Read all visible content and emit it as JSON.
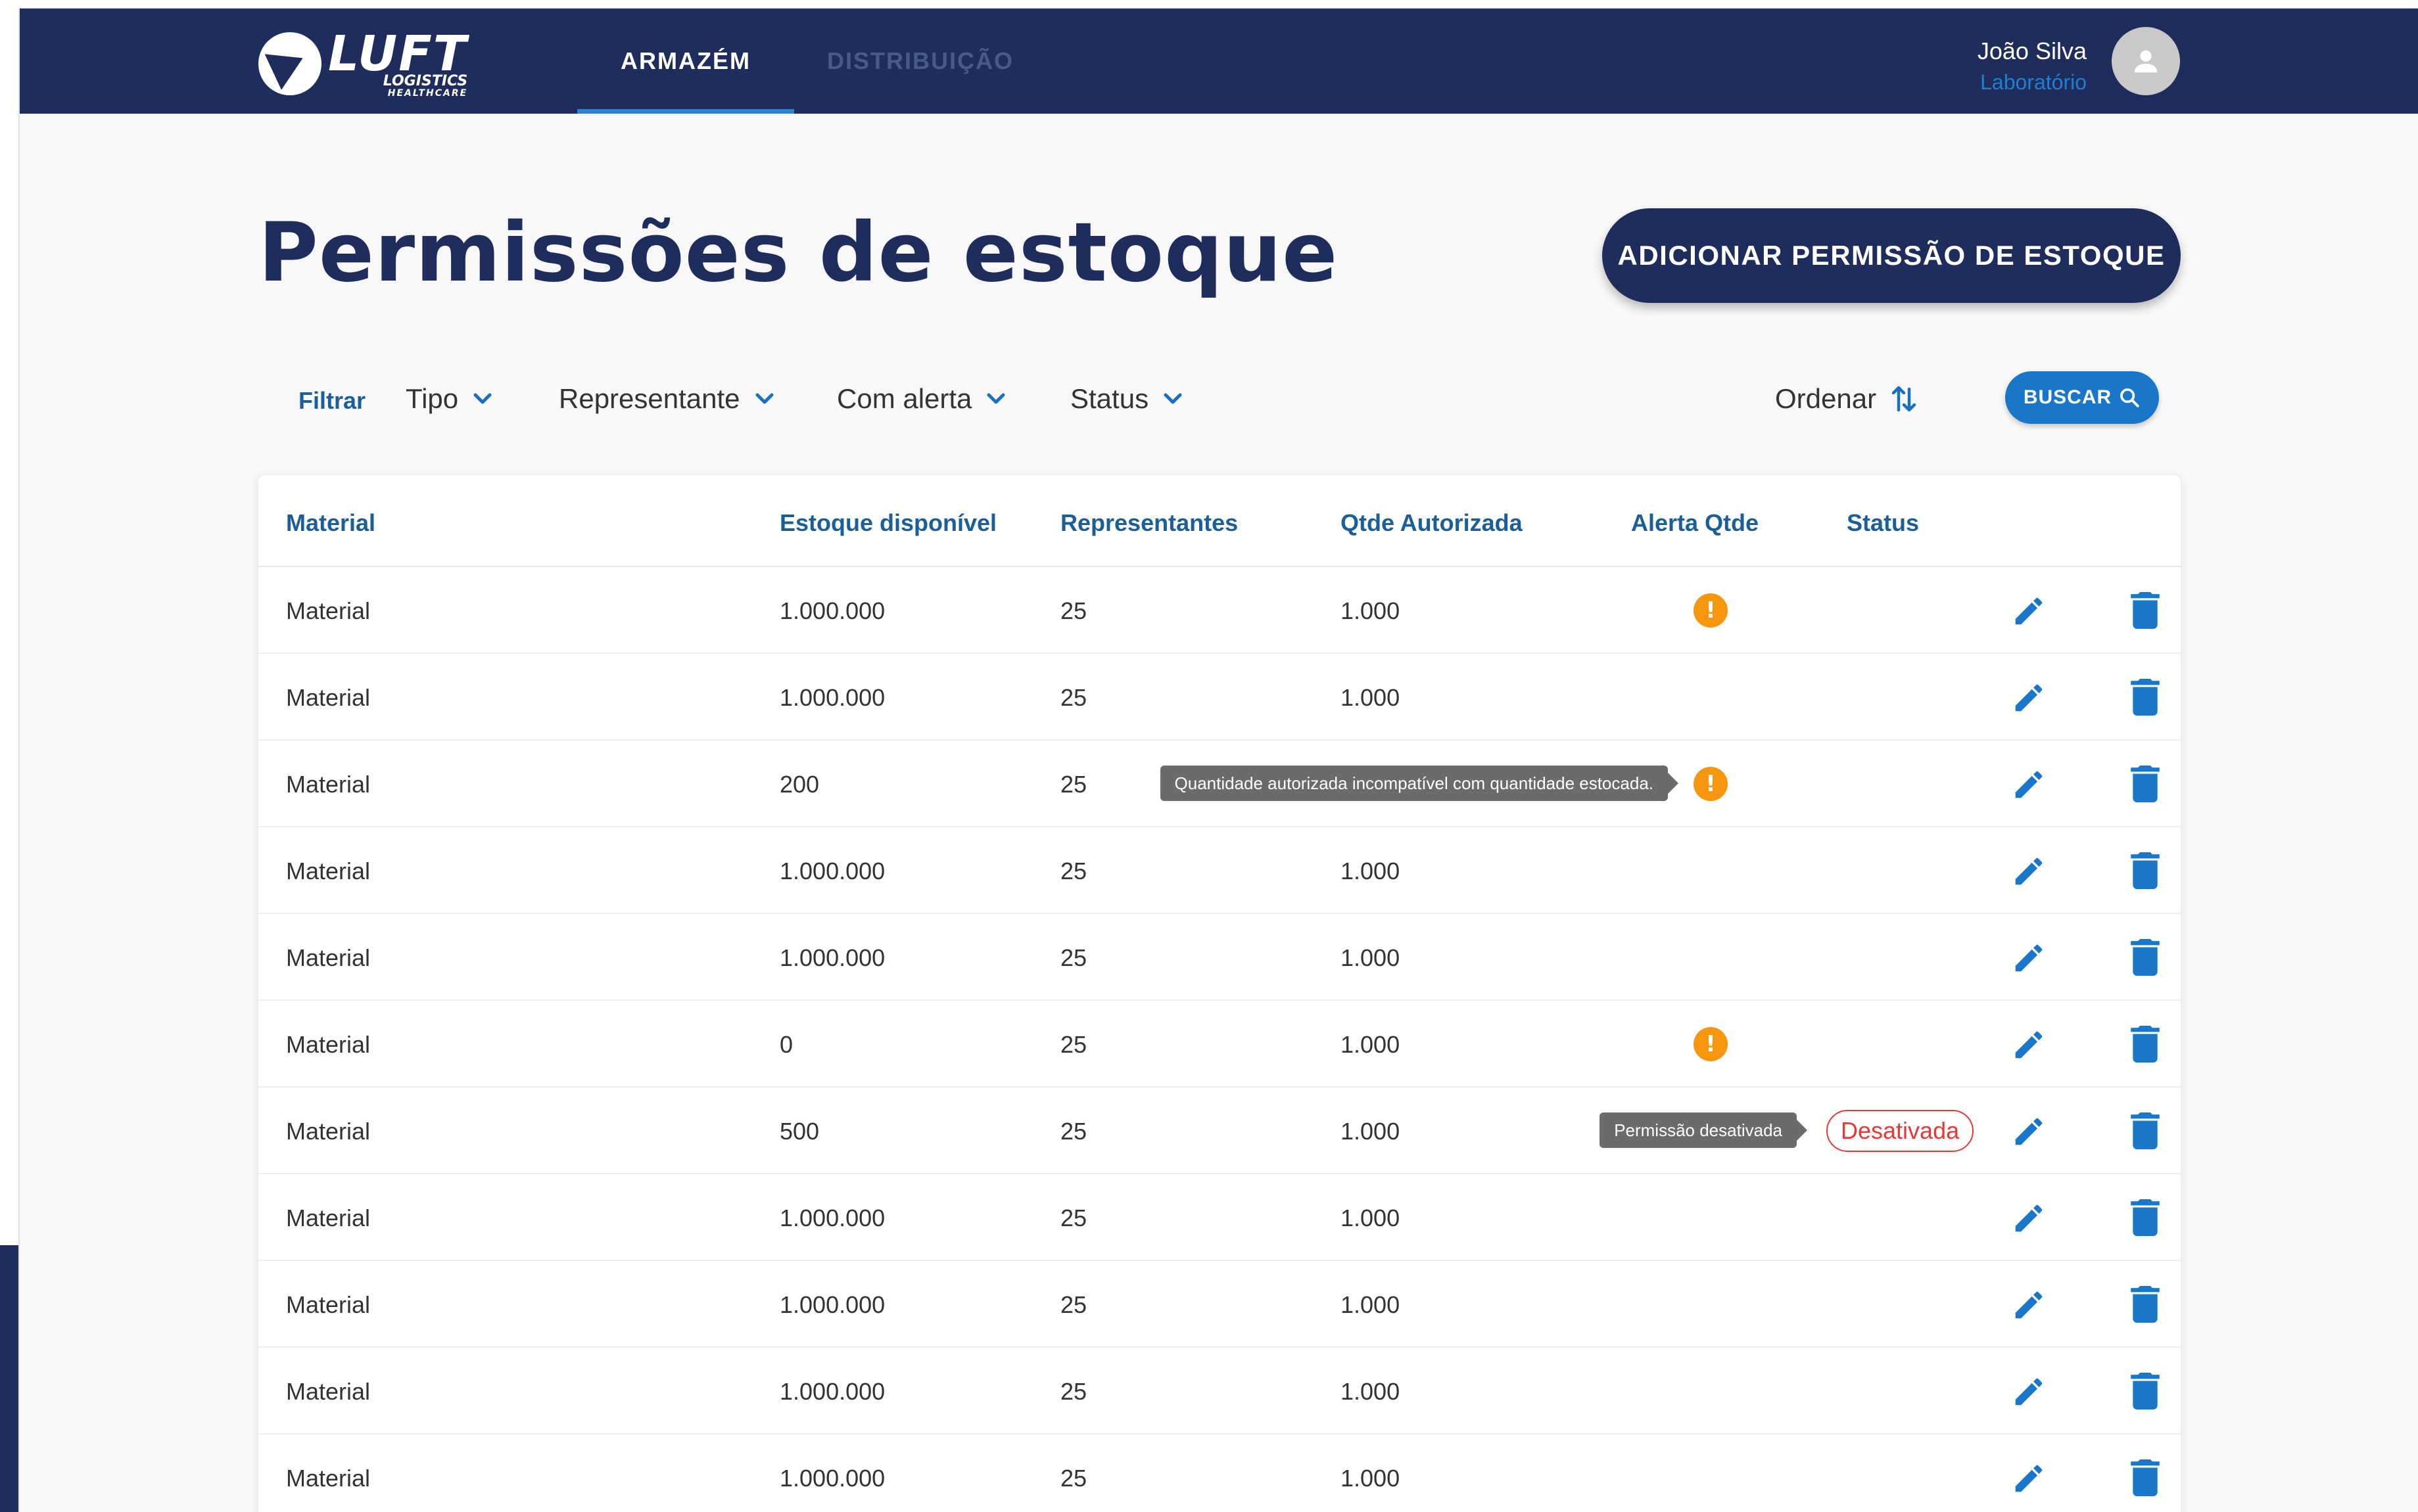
{
  "header": {
    "logo": {
      "main": "LUFT",
      "sub": "LOGISTICS",
      "sub2": "HEALTHCARE"
    },
    "tabs": [
      {
        "label": "ARMAZÉM",
        "active": true
      },
      {
        "label": "DISTRIBUIÇÃO",
        "active": false
      }
    ],
    "user": {
      "name": "João Silva",
      "role": "Laboratório"
    }
  },
  "page": {
    "title": "Permissões de estoque",
    "add_button_label": "ADICIONAR PERMISSÃO DE ESTOQUE"
  },
  "filters": {
    "label": "Filtrar",
    "dropdowns": [
      "Tipo",
      "Representante",
      "Com alerta",
      "Status"
    ],
    "sort_label": "Ordenar",
    "search_label": "BUSCAR"
  },
  "table": {
    "columns": [
      "Material",
      "Estoque disponível",
      "Representantes",
      "Qtde Autorizada",
      "Alerta Qtde",
      "Status"
    ],
    "rows": [
      {
        "material": "Material",
        "stock": "1.000.000",
        "reps": "25",
        "qty": "1.000",
        "alert": true,
        "tooltip": "",
        "status": ""
      },
      {
        "material": "Material",
        "stock": "1.000.000",
        "reps": "25",
        "qty": "1.000",
        "alert": false,
        "tooltip": "",
        "status": ""
      },
      {
        "material": "Material",
        "stock": "200",
        "reps": "25",
        "qty": "",
        "alert": true,
        "tooltip": "Quantidade autorizada incompatível com quantidade estocada.",
        "status": ""
      },
      {
        "material": "Material",
        "stock": "1.000.000",
        "reps": "25",
        "qty": "1.000",
        "alert": false,
        "tooltip": "",
        "status": ""
      },
      {
        "material": "Material",
        "stock": "1.000.000",
        "reps": "25",
        "qty": "1.000",
        "alert": false,
        "tooltip": "",
        "status": ""
      },
      {
        "material": "Material",
        "stock": "0",
        "reps": "25",
        "qty": "1.000",
        "alert": true,
        "tooltip": "",
        "status": ""
      },
      {
        "material": "Material",
        "stock": "500",
        "reps": "25",
        "qty": "1.000",
        "alert": false,
        "tooltip": "Permissão desativada",
        "status": "Desativada"
      },
      {
        "material": "Material",
        "stock": "1.000.000",
        "reps": "25",
        "qty": "1.000",
        "alert": false,
        "tooltip": "",
        "status": ""
      },
      {
        "material": "Material",
        "stock": "1.000.000",
        "reps": "25",
        "qty": "1.000",
        "alert": false,
        "tooltip": "",
        "status": ""
      },
      {
        "material": "Material",
        "stock": "1.000.000",
        "reps": "25",
        "qty": "1.000",
        "alert": false,
        "tooltip": "",
        "status": ""
      },
      {
        "material": "Material",
        "stock": "1.000.000",
        "reps": "25",
        "qty": "1.000",
        "alert": false,
        "tooltip": "",
        "status": ""
      }
    ],
    "alert_glyph": "!",
    "edit_icon": "pencil-icon",
    "delete_icon": "trash-icon"
  },
  "colors": {
    "navy": "#1f2d5c",
    "blue": "#1877c9",
    "alert": "#f6960f",
    "danger": "#e53935"
  }
}
